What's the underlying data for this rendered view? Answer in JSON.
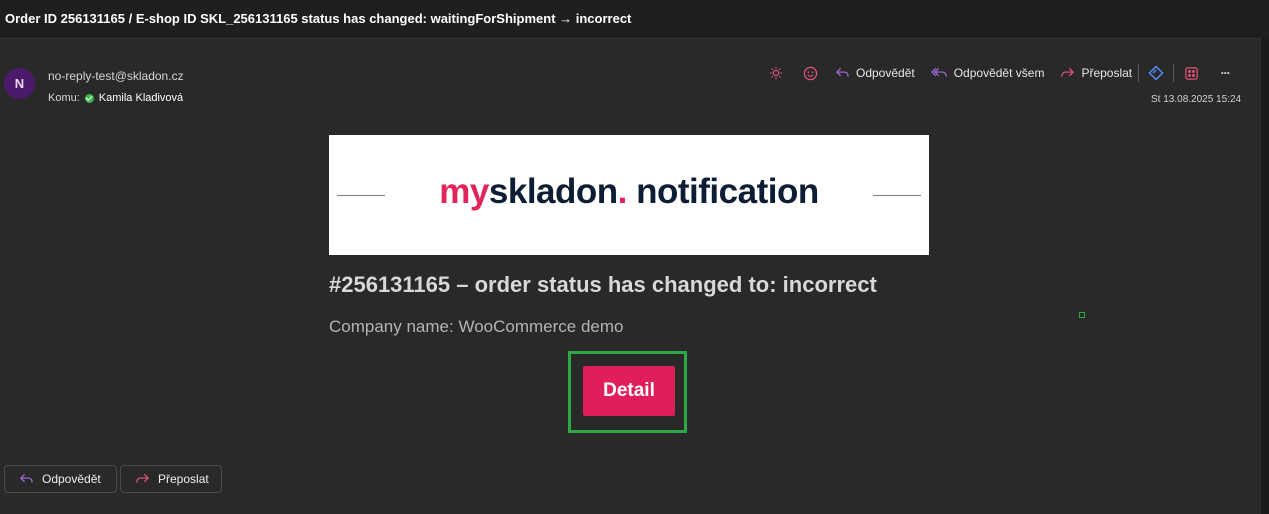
{
  "email": {
    "subject": "Order ID 256131165 / E-shop ID SKL_256131165 status has changed: waitingForShipment → incorrect",
    "avatar_initial": "N",
    "from": "no-reply-test@skladon.cz",
    "to_label": "Komu:",
    "recipient": "Kamila Kladivová",
    "date": "St 13.08.2025 15:24"
  },
  "toolbar": {
    "reply_label": "Odpovědět",
    "reply_all_label": "Odpovědět všem",
    "forward_label": "Přeposlat",
    "more_label": "···",
    "icons": [
      "sun-icon",
      "emoji-icon",
      "reply-icon",
      "reply-all-icon",
      "forward-icon",
      "diamond-icon",
      "apps-icon",
      "more-icon"
    ]
  },
  "body": {
    "brand_part1": "my",
    "brand_part2": "skladon",
    "brand_dot": ".",
    "brand_part3": " notification",
    "headline": "#256131165 – order status has changed to: incorrect",
    "company": "Company name: WooCommerce demo",
    "detail_label": "Detail"
  },
  "footer": {
    "reply_label": "Odpovědět",
    "forward_label": "Přeposlat"
  },
  "colors": {
    "background": "#292929",
    "accent_pink": "#e01e5a",
    "brand_navy": "#0c1d34",
    "highlight_green": "#2ea844",
    "icon_pink": "#e8547a",
    "icon_purple": "#a56bd6",
    "icon_blue": "#5b8cff"
  }
}
